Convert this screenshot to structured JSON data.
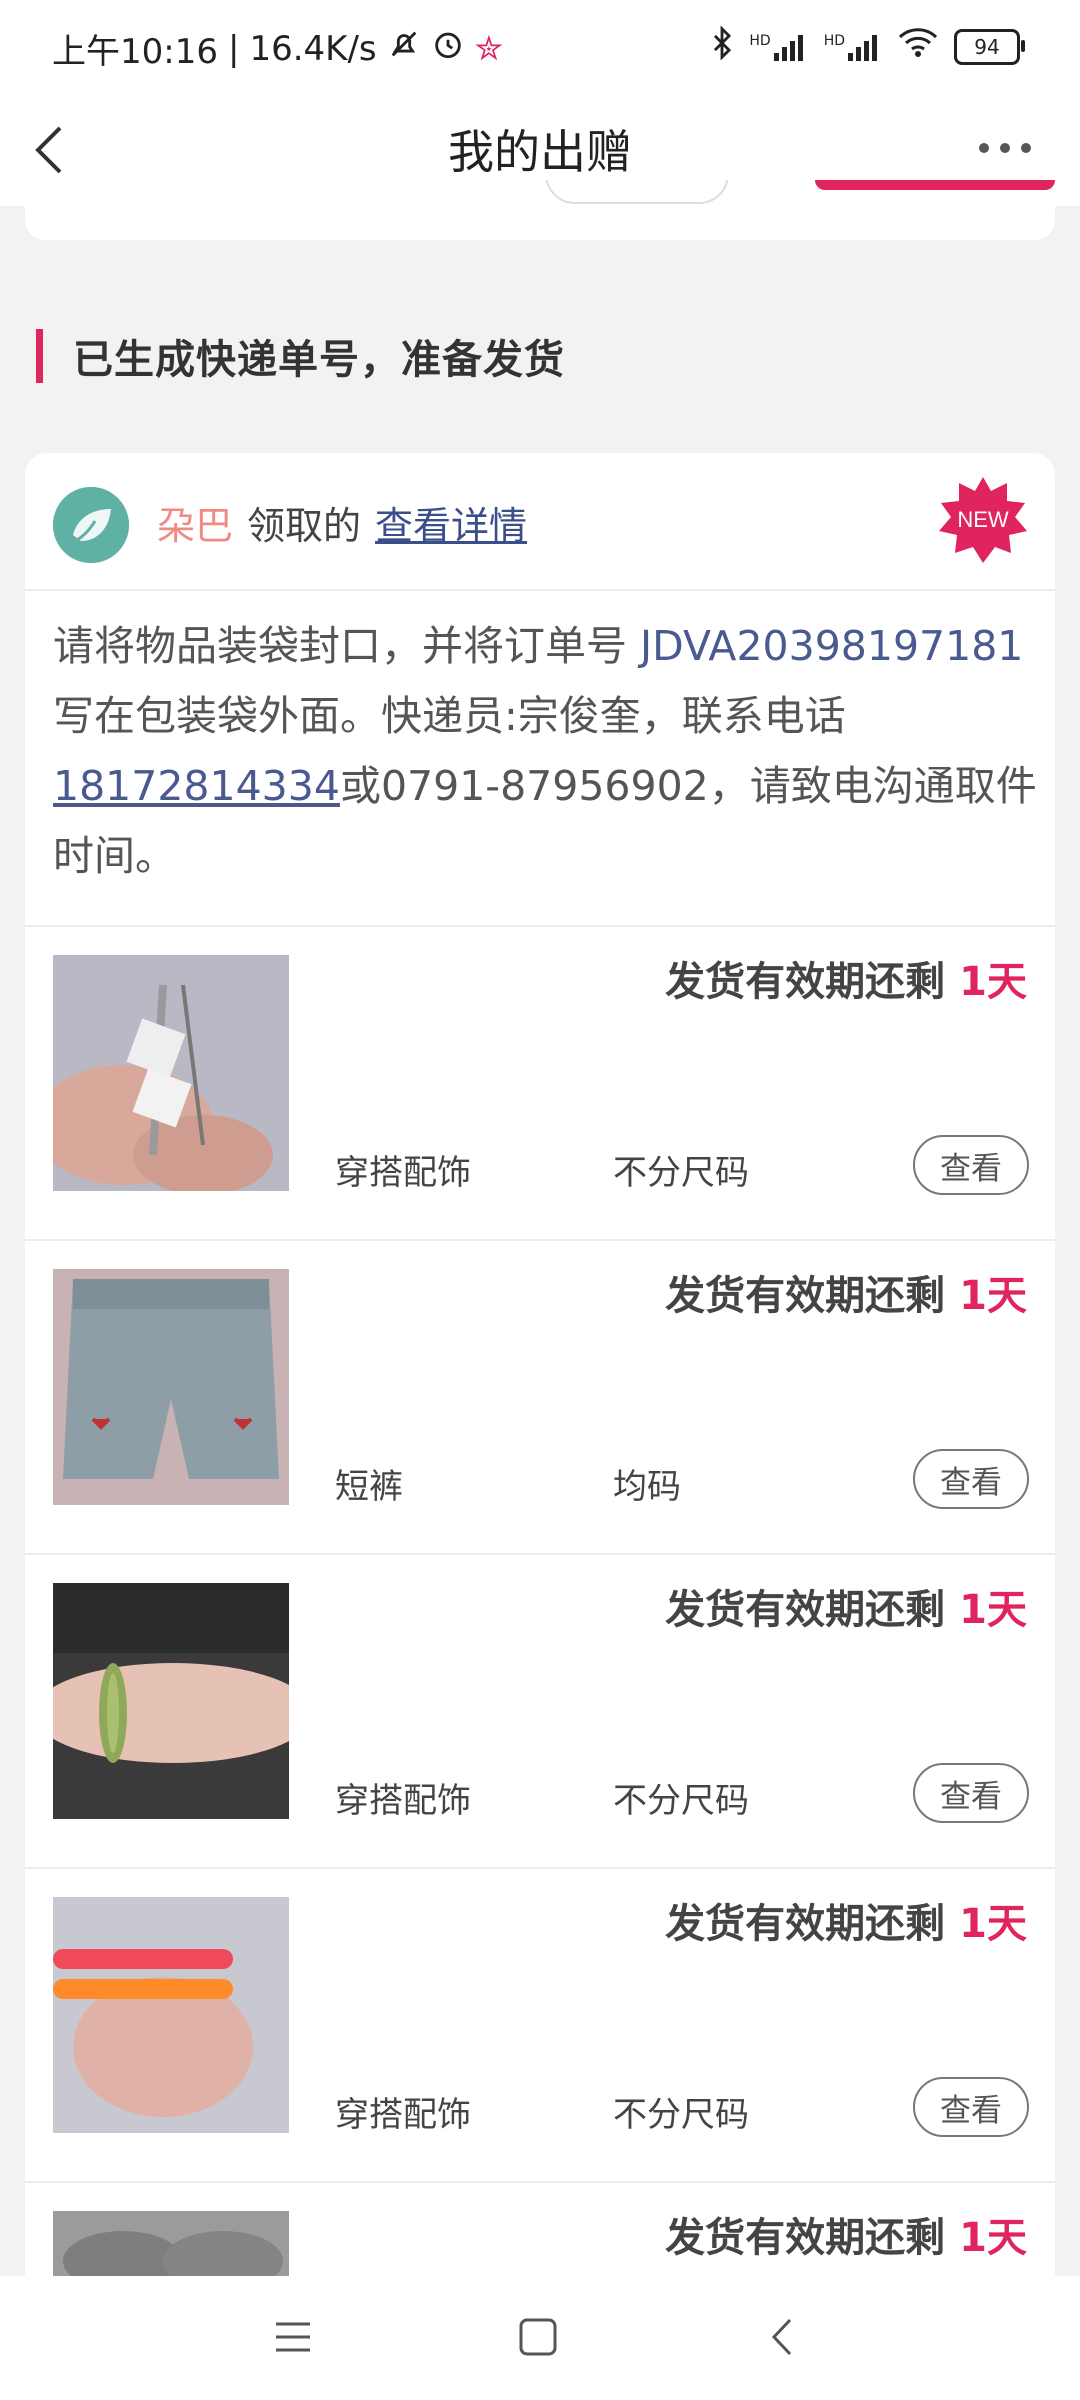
{
  "status_bar": {
    "time": "上午10:16",
    "separator": "|",
    "speed": "16.4K/s",
    "network_1": "HD",
    "network_2": "HD",
    "battery": "94"
  },
  "nav": {
    "title": "我的出赠"
  },
  "section": {
    "title": "已生成快递单号，准备发货"
  },
  "card": {
    "receiver": "朶巴",
    "receive_text": "领取的",
    "detail_link": "查看详情",
    "badge": "NEW",
    "notice": {
      "part1": "请将物品装袋封口，并将订单号 ",
      "order_no": "JDVA20398197181",
      "part2": " 写在包装袋外面。快递员:宗俊奎，联系电话",
      "phone": "18172814334",
      "part3": "或0791-87956902，请致电沟通取件时间。"
    },
    "items": [
      {
        "deadline": "发货有效期还剩",
        "days": "1天",
        "category": "穿搭配饰",
        "size": "不分尺码",
        "button": "查看"
      },
      {
        "deadline": "发货有效期还剩",
        "days": "1天",
        "category": "短裤",
        "size": "均码",
        "button": "查看"
      },
      {
        "deadline": "发货有效期还剩",
        "days": "1天",
        "category": "穿搭配饰",
        "size": "不分尺码",
        "button": "查看"
      },
      {
        "deadline": "发货有效期还剩",
        "days": "1天",
        "category": "穿搭配饰",
        "size": "不分尺码",
        "button": "查看"
      },
      {
        "deadline": "发货有效期还剩",
        "days": "1天"
      }
    ]
  }
}
